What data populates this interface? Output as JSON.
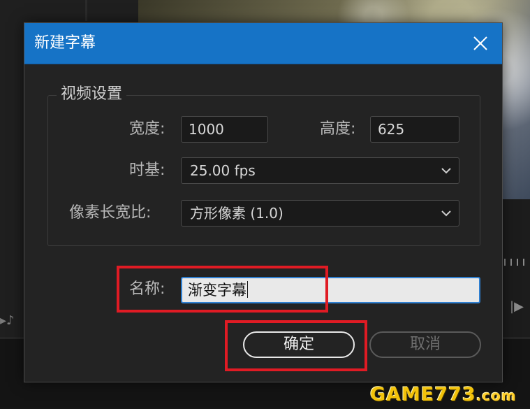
{
  "dialog": {
    "title": "新建字幕",
    "close_icon": "close-icon",
    "video_settings": {
      "legend": "视频设置",
      "width_label": "宽度:",
      "width_value": "1000",
      "height_label": "高度:",
      "height_value": "625",
      "timebase_label": "时基:",
      "timebase_value": "25.00 fps",
      "aspect_label": "像素长宽比:",
      "aspect_value": "方形像素 (1.0)"
    },
    "name_label": "名称:",
    "name_value": "渐变字幕",
    "ok_label": "确定",
    "cancel_label": "取消"
  },
  "watermark": {
    "main": "GAME773",
    "suffix": ".com"
  },
  "colors": {
    "title_bar": "#1673c6",
    "highlight": "#e01b24",
    "dialog_bg": "#232323"
  }
}
